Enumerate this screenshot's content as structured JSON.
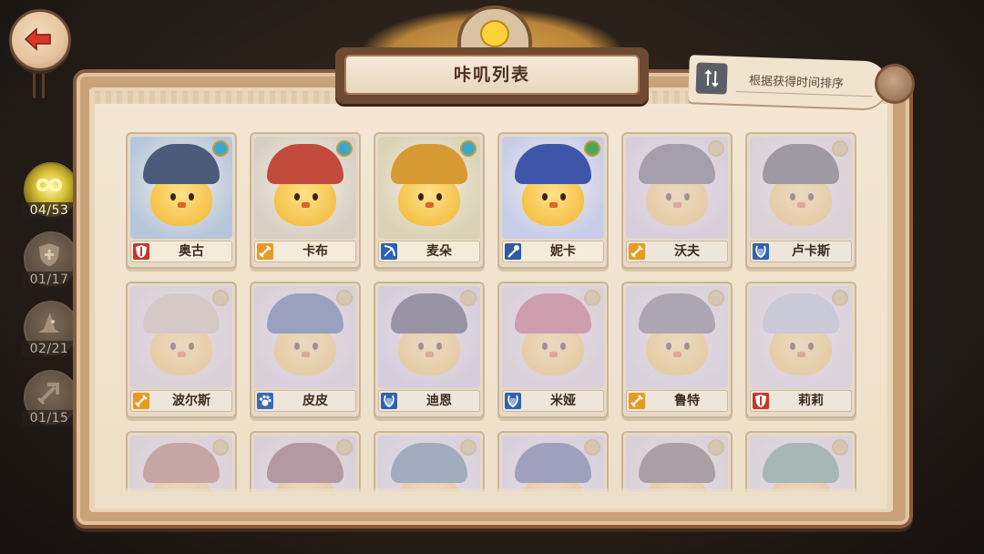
{
  "title": "咔叽列表",
  "sort": {
    "label": "根据获得时间排序"
  },
  "filters": [
    {
      "id": "all",
      "icon": "infinity-icon",
      "count": "04/53",
      "active": true
    },
    {
      "id": "healer",
      "icon": "shield-cross-icon",
      "count": "01/17",
      "active": false
    },
    {
      "id": "mage",
      "icon": "wizard-hat-icon",
      "count": "02/21",
      "active": false
    },
    {
      "id": "archer",
      "icon": "arrow-icon",
      "count": "01/15",
      "active": false
    }
  ],
  "characters": [
    {
      "name": "奥古",
      "role": "defender",
      "role_icon": "shield-icon",
      "locked": false,
      "hat": "#4b5a78",
      "bg": "#b7c7db",
      "gem": "#39a9c8"
    },
    {
      "name": "卡布",
      "role": "warrior",
      "role_icon": "sword-icon",
      "locked": false,
      "hat": "#c24a3c",
      "bg": "#d7cfc3",
      "gem": "#39a9c8"
    },
    {
      "name": "麦朵",
      "role": "archer",
      "role_icon": "bow-icon",
      "locked": false,
      "hat": "#d79a33",
      "bg": "#d9d2b5",
      "gem": "#39a9c8"
    },
    {
      "name": "妮卡",
      "role": "mage",
      "role_icon": "staff-icon",
      "locked": false,
      "hat": "#3f56a8",
      "bg": "#c7cde8",
      "gem": "#4aa852"
    },
    {
      "name": "沃夫",
      "role": "warrior",
      "role_icon": "sword-icon",
      "locked": true,
      "hat": "#4a4a52",
      "bg": "#cfc6d0",
      "gem": "#c8b46a"
    },
    {
      "name": "卢卡斯",
      "role": "bard",
      "role_icon": "lyre-icon",
      "locked": true,
      "hat": "#3b3a3a",
      "bg": "#d8cfc9",
      "gem": "#c8b46a"
    },
    {
      "name": "波尔斯",
      "role": "warrior",
      "role_icon": "sword-icon",
      "locked": true,
      "hat": "#c7b89d",
      "bg": "#d4cbc7",
      "gem": "#c8b46a"
    },
    {
      "name": "皮皮",
      "role": "beast",
      "role_icon": "paw-icon",
      "locked": true,
      "hat": "#2f4f8a",
      "bg": "#cfc8cc",
      "gem": "#c8b46a"
    },
    {
      "name": "迪恩",
      "role": "bard",
      "role_icon": "lyre-icon",
      "locked": true,
      "hat": "#2b2c46",
      "bg": "#c9c3d0",
      "gem": "#c8b46a"
    },
    {
      "name": "米娅",
      "role": "bard",
      "role_icon": "lyre-icon",
      "locked": true,
      "hat": "#b5485a",
      "bg": "#d4c7cc",
      "gem": "#c8b46a"
    },
    {
      "name": "鲁特",
      "role": "warrior",
      "role_icon": "sword-icon",
      "locked": true,
      "hat": "#5a5e64",
      "bg": "#d0cccf",
      "gem": "#c8b46a"
    },
    {
      "name": "莉莉",
      "role": "defender",
      "role_icon": "shield-icon",
      "locked": true,
      "hat": "#a9b9c8",
      "bg": "#d6cfd2",
      "gem": "#c8b46a"
    },
    {
      "name": "",
      "role": "",
      "role_icon": "",
      "locked": true,
      "hat": "#a35a3c",
      "bg": "#d6cac4",
      "gem": "#c8b46a"
    },
    {
      "name": "",
      "role": "",
      "role_icon": "",
      "locked": true,
      "hat": "#6c3a3a",
      "bg": "#d2c8c8",
      "gem": "#c8b46a"
    },
    {
      "name": "",
      "role": "",
      "role_icon": "",
      "locked": true,
      "hat": "#3f6c8a",
      "bg": "#cfcad2",
      "gem": "#c8b46a"
    },
    {
      "name": "",
      "role": "",
      "role_icon": "",
      "locked": true,
      "hat": "#3b4d82",
      "bg": "#cdc8d3",
      "gem": "#c8b46a"
    },
    {
      "name": "",
      "role": "",
      "role_icon": "",
      "locked": true,
      "hat": "#5b4a44",
      "bg": "#d0c8c6",
      "gem": "#c8b46a"
    },
    {
      "name": "",
      "role": "",
      "role_icon": "",
      "locked": true,
      "hat": "#4d8a6a",
      "bg": "#d2cfc8",
      "gem": "#c8b46a"
    }
  ]
}
